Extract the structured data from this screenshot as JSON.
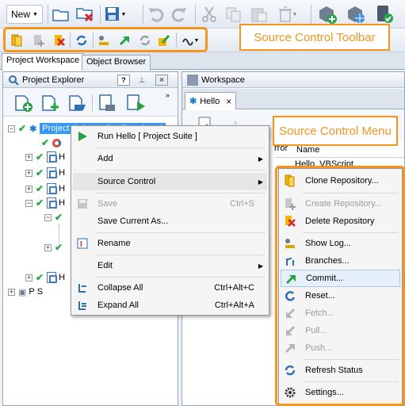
{
  "toolbar": {
    "new_label": "New"
  },
  "callouts": {
    "toolbar": "Source Control Toolbar",
    "menu": "Source Control Menu"
  },
  "tabs": {
    "project_workspace": "Project Workspace",
    "object_browser": "Object Browser"
  },
  "explorer": {
    "title": "Project Explorer",
    "root": "Project Suite 'Hello' (5 projects)",
    "item_h": "H"
  },
  "workspace": {
    "title": "Workspace",
    "tab": "Hello",
    "col_name": "Name",
    "col_prefix": "rror",
    "cell": "Hello_VBScript"
  },
  "context_menu": {
    "run": "Run Hello  [ Project Suite ]",
    "add": "Add",
    "source_control": "Source Control",
    "save": "Save",
    "save_sc": "Ctrl+S",
    "save_as": "Save Current As...",
    "rename": "Rename",
    "edit": "Edit",
    "collapse": "Collapse All",
    "collapse_sc": "Ctrl+Alt+C",
    "expand": "Expand All",
    "expand_sc": "Ctrl+Alt+A"
  },
  "sc_menu": {
    "clone": "Clone Repository...",
    "create": "Create Repository...",
    "delete": "Delete Repository",
    "show_log": "Show Log...",
    "branches": "Branches...",
    "commit": "Commit...",
    "reset": "Reset...",
    "fetch": "Fetch...",
    "pull": "Pull...",
    "push": "Push...",
    "refresh": "Refresh Status",
    "settings": "Settings..."
  },
  "colors": {
    "accent": "#f7941d",
    "selection": "#3399ff"
  }
}
